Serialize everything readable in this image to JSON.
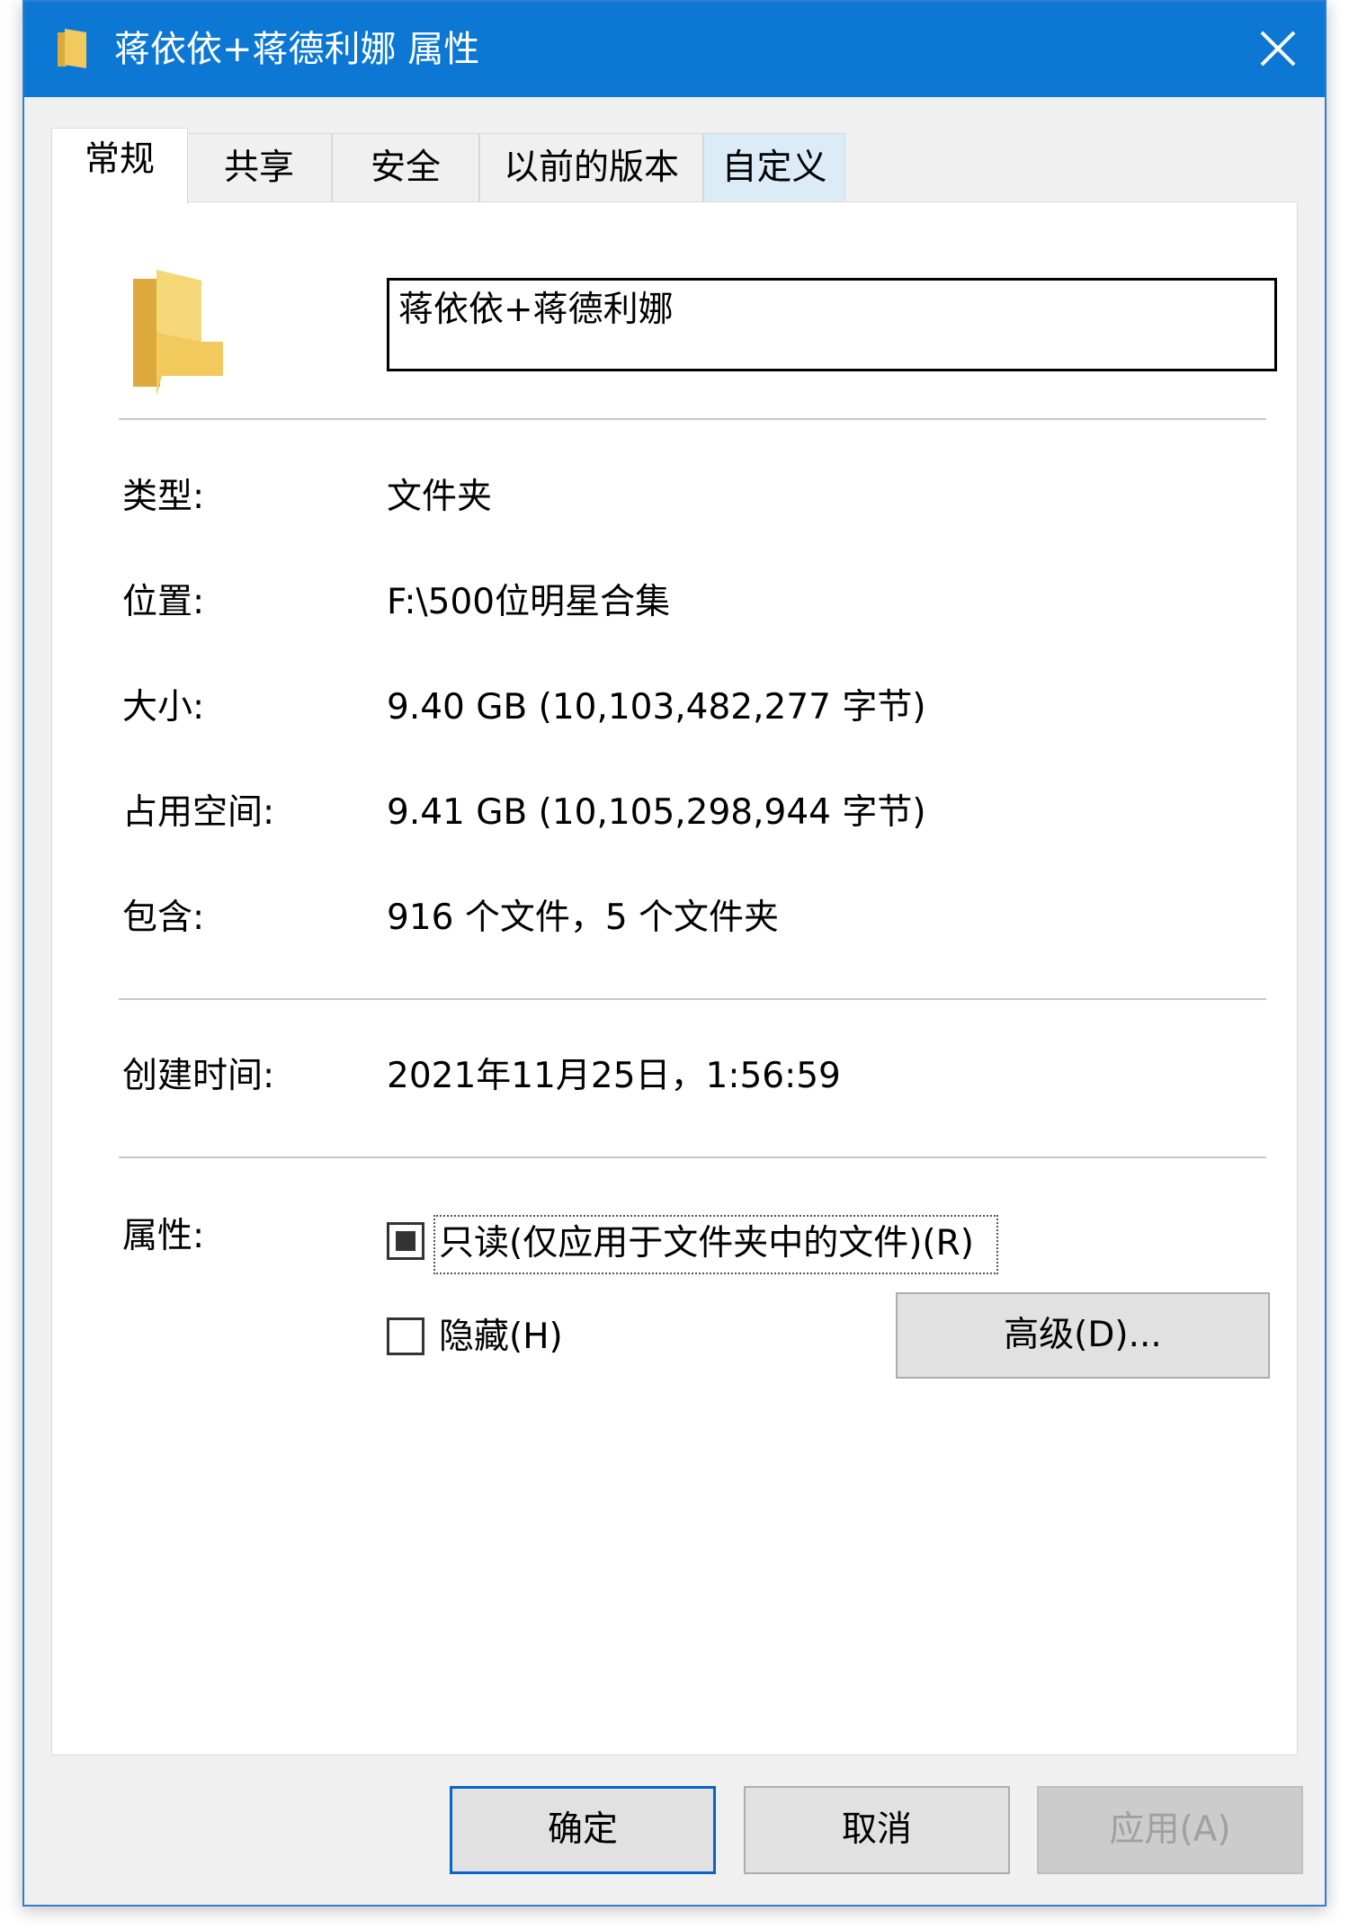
{
  "titlebar": {
    "title": "蒋依依+蒋德利娜 属性",
    "icon": "folder-icon",
    "close_icon": "close-icon"
  },
  "tabs": [
    {
      "label": "常规",
      "active": true
    },
    {
      "label": "共享"
    },
    {
      "label": "安全"
    },
    {
      "label": "以前的版本"
    },
    {
      "label": "自定义"
    }
  ],
  "general": {
    "folder_icon": "folder-icon",
    "name_value": "蒋依依+蒋德利娜",
    "rows": [
      {
        "label": "类型:",
        "value": "文件夹"
      },
      {
        "label": "位置:",
        "value": "F:\\500位明星合集"
      },
      {
        "label": "大小:",
        "value": "9.40 GB (10,103,482,277 字节)"
      },
      {
        "label": "占用空间:",
        "value": "9.41 GB (10,105,298,944 字节)"
      },
      {
        "label": "包含:",
        "value": "916 个文件，5 个文件夹"
      }
    ],
    "created": {
      "label": "创建时间:",
      "value": "2021年11月25日，1:56:59"
    },
    "attributes": {
      "label": "属性:",
      "readonly_label": "只读(仅应用于文件夹中的文件)(R)",
      "readonly_state": "indeterminate",
      "hidden_label": "隐藏(H)",
      "hidden_checked": false,
      "advanced_button": "高级(D)..."
    }
  },
  "buttons": {
    "ok": "确定",
    "cancel": "取消",
    "apply": "应用(A)"
  },
  "colors": {
    "titlebar": "#0c78d4",
    "primary_border": "#0a64c8",
    "folder": "#f2c95c"
  }
}
